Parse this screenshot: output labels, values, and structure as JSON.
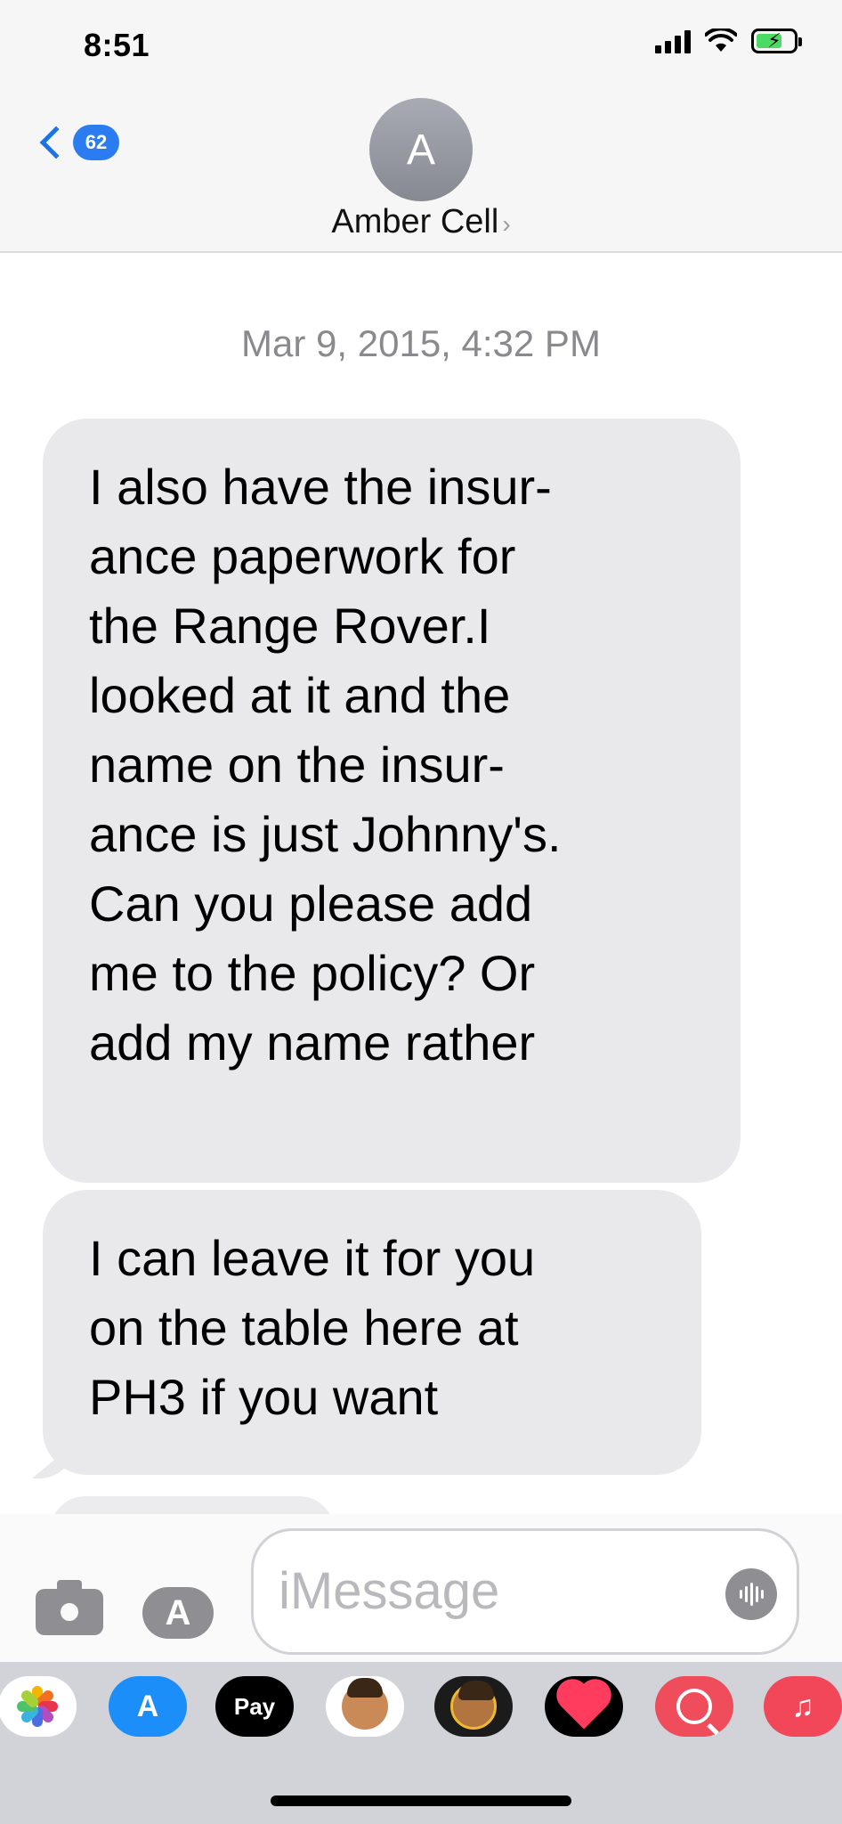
{
  "status_bar": {
    "time": "8:51",
    "icons": [
      "signal-icon",
      "wifi-icon",
      "battery-charging-icon"
    ]
  },
  "header": {
    "back_badge": "62",
    "avatar_initial": "A",
    "contact_name": "Amber Cell",
    "contact_chevron": "›"
  },
  "conversation": {
    "timestamp": "Mar 9, 2015, 4:32 PM",
    "messages": [
      {
        "direction": "incoming",
        "lines": [
          "I also have the insur-",
          "ance paperwork for",
          "the Range Rover.I",
          "looked at it and the",
          "name on the insur-",
          "ance is just Johnny's.",
          "Can you please add",
          "me to the policy? Or",
          "add my name rather"
        ]
      },
      {
        "direction": "incoming",
        "lines": [
          "I can leave it for you",
          "on the table here at",
          "PH3 if you want"
        ]
      }
    ]
  },
  "input_bar": {
    "placeholder": "iMessage",
    "apps_glyph": "A"
  },
  "app_drawer": {
    "apps": [
      "photos-icon",
      "app-store-icon",
      "apple-pay-icon",
      "memoji-stickers-icon",
      "animoji-icon",
      "digital-touch-icon",
      "images-search-icon",
      "music-icon"
    ],
    "pay_label": "Pay",
    "pay_glyph": "",
    "music_glyph": "♫",
    "store_glyph": "A"
  },
  "colors": {
    "accent": "#1a73e8",
    "bubble_incoming": "#e9e9eb",
    "header_bg": "#f6f6f7",
    "drawer_bg": "#d1d3d9"
  }
}
